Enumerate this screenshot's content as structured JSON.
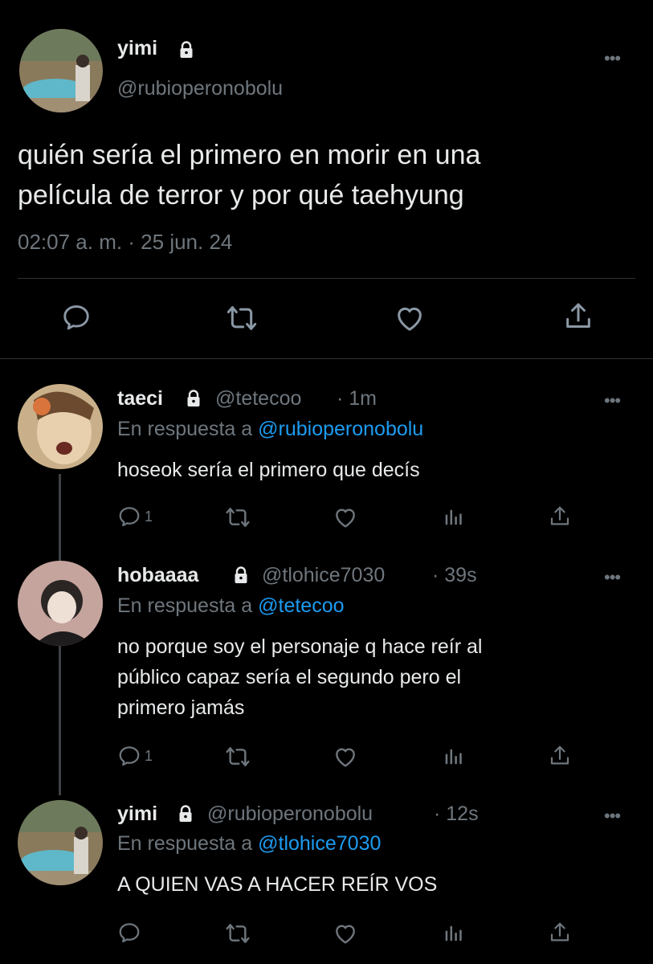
{
  "main_tweet": {
    "display_name": "yimi",
    "handle": "@rubioperonobolu",
    "text_line1": "quién sería el primero en morir en una",
    "text_line2": "película de terror y por qué taehyung",
    "timestamp": "02:07 a. m. · 25 jun. 24",
    "actions": [
      "reply-icon",
      "retweet-icon",
      "like-icon",
      "share-icon"
    ]
  },
  "replies": [
    {
      "display_name": "taeci",
      "handle": "@tetecoo",
      "age": "· 1m",
      "reply_prefix": "En respuesta a",
      "reply_to": "@rubioperonobolu",
      "text": [
        "hoseok sería el primero que decís"
      ],
      "reply_count": "1"
    },
    {
      "display_name": "hobaaaa",
      "handle": "@tlohice7030",
      "age": "· 39s",
      "reply_prefix": "En respuesta a",
      "reply_to": "@tetecoo",
      "text": [
        "no porque soy el personaje q hace reír al",
        "público capaz sería el segundo pero el",
        "primero jamás"
      ],
      "reply_count": "1"
    },
    {
      "display_name": "yimi",
      "handle": "@rubioperonobolu",
      "age": "· 12s",
      "reply_prefix": "En respuesta a",
      "reply_to": "@tlohice7030",
      "text": [
        "A QUIEN VAS A HACER REÍR VOS"
      ],
      "reply_count": ""
    }
  ],
  "more_glyph": "•••",
  "colors": {
    "background": "#000000",
    "text": "#e7e9ea",
    "muted": "#6e767d",
    "link": "#1d9bf0",
    "divider": "#2f3336"
  }
}
